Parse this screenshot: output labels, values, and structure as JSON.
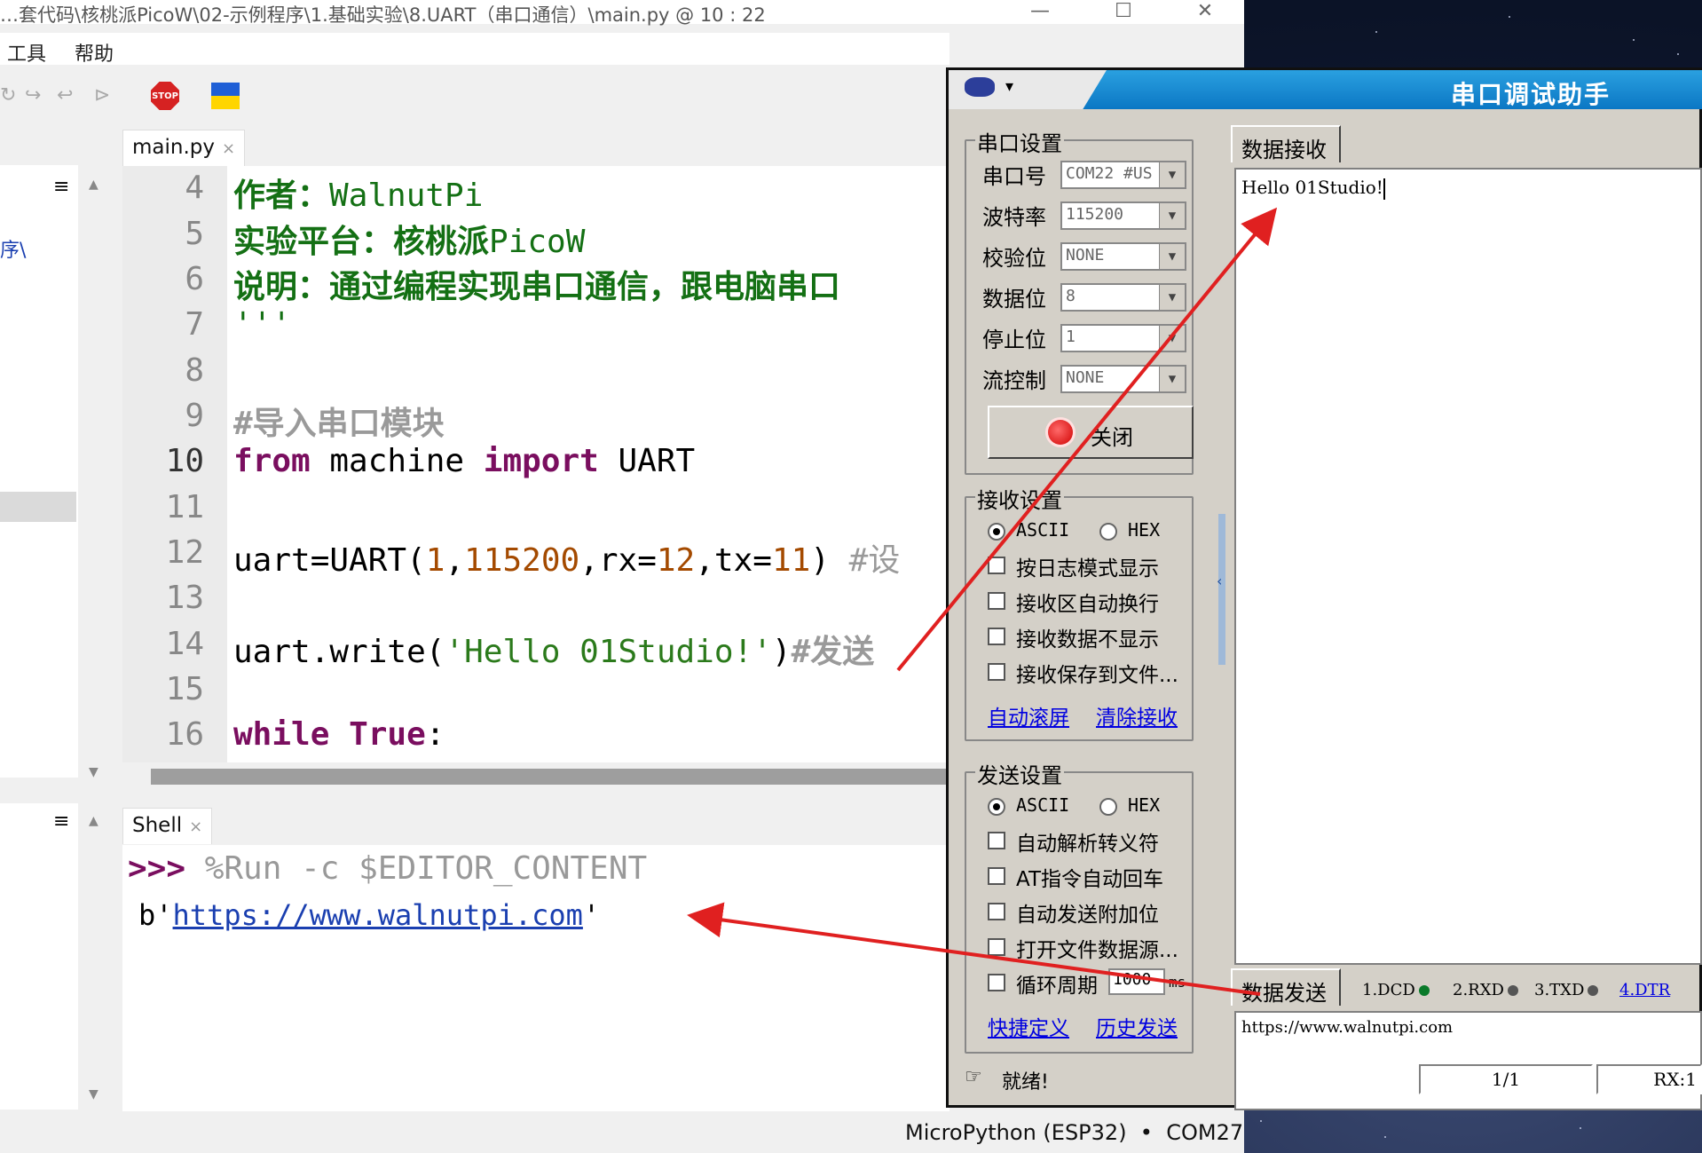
{
  "thonny": {
    "title": "…套代码\\核桃派PicoW\\02-示例程序\\1.基础实验\\8.UART（串口通信）\\main.py  @  10 : 22",
    "win_min": "—",
    "win_max": "☐",
    "win_close": "✕",
    "menu": [
      "工具",
      "帮助"
    ],
    "stop_label": "STOP",
    "toolbar_glyphs": [
      "↻",
      "↪",
      "↩",
      "⊳"
    ],
    "left_path_fragment": "序\\",
    "editor_tab": "main.py",
    "shell_tab": "Shell",
    "tab_close": "×",
    "hamburger": "≡",
    "scroll_up": "▲",
    "scroll_down": "▼",
    "lines": [
      "4",
      "5",
      "6",
      "7",
      "8",
      "9",
      "10",
      "11",
      "12",
      "13",
      "14",
      "15",
      "16"
    ],
    "code": {
      "l4_a": "作者：",
      "l4_b": "WalnutPi",
      "l5_a": "实验平台：核桃派",
      "l5_b": "PicoW",
      "l6": "说明：通过编程实现串口通信，跟电脑串口",
      "l7": "'''",
      "l9": "#导入串口模块",
      "l10_kw1": "from",
      "l10_mid": " machine ",
      "l10_kw2": "import",
      "l10_end": " UART",
      "l12_a": "uart=UART(",
      "l12_n1": "1",
      "l12_c1": ",",
      "l12_n2": "115200",
      "l12_c2": ",rx=",
      "l12_n3": "12",
      "l12_c3": ",tx=",
      "l12_n4": "11",
      "l12_c4": ") ",
      "l12_cm": "#设",
      "l14_a": "uart.write(",
      "l14_str": "'Hello 01Studio!'",
      "l14_b": ")",
      "l14_cm": "#发送",
      "l16_kw1": "while",
      "l16_sp": " ",
      "l16_kw2": "True",
      "l16_end": ":"
    },
    "shell": {
      "prompt": ">>>",
      "cmd": " %Run -c $EDITOR_CONTENT",
      "out_a": "b'",
      "out_url": "https://www.walnutpi.com",
      "out_b": "'"
    },
    "status": "MicroPython (ESP32)  •  COM27"
  },
  "serial": {
    "title": "串口调试助手",
    "menu_glyph": "▾",
    "port_group": "串口设置",
    "port_label": "串口号",
    "port_value": "COM22 #US",
    "baud_label": "波特率",
    "baud_value": "115200",
    "parity_label": "校验位",
    "parity_value": "NONE",
    "data_label": "数据位",
    "data_value": "8",
    "stop_label": "停止位",
    "stop_value": "1",
    "flow_label": "流控制",
    "flow_value": "NONE",
    "combo_arrow": "▼",
    "open_btn": "关闭",
    "rx_group": "接收设置",
    "rx_ascii": "ASCII",
    "rx_hex": "HEX",
    "rx_opts": [
      "按日志模式显示",
      "接收区自动换行",
      "接收数据不显示",
      "接收保存到文件..."
    ],
    "rx_link1": "自动滚屏",
    "rx_link2": "清除接收",
    "tx_group": "发送设置",
    "tx_ascii": "ASCII",
    "tx_hex": "HEX",
    "tx_opts": [
      "自动解析转义符",
      "AT指令自动回车",
      "自动发送附加位",
      "打开文件数据源..."
    ],
    "tx_loop": "循环周期",
    "tx_loop_value": "1000",
    "tx_loop_unit": "ms",
    "tx_link1": "快捷定义",
    "tx_link2": "历史发送",
    "rx_tab": "数据接收",
    "rx_text": "Hello 01Studio!",
    "tx_tab": "数据发送",
    "pins": [
      "1.DCD",
      "2.RXD",
      "3.TXD",
      "4.DTR"
    ],
    "pin_colors": [
      "#0a7a2a",
      "#555555",
      "#555555"
    ],
    "tx_text": "https://www.walnutpi.com",
    "ready_icon": "☞",
    "ready": "就绪!",
    "count": "1/1",
    "rx_count": "RX:1"
  },
  "colors": {
    "arrow": "#e02020",
    "flag_blue": "#1f5fd6",
    "flag_yellow": "#ffd500"
  }
}
